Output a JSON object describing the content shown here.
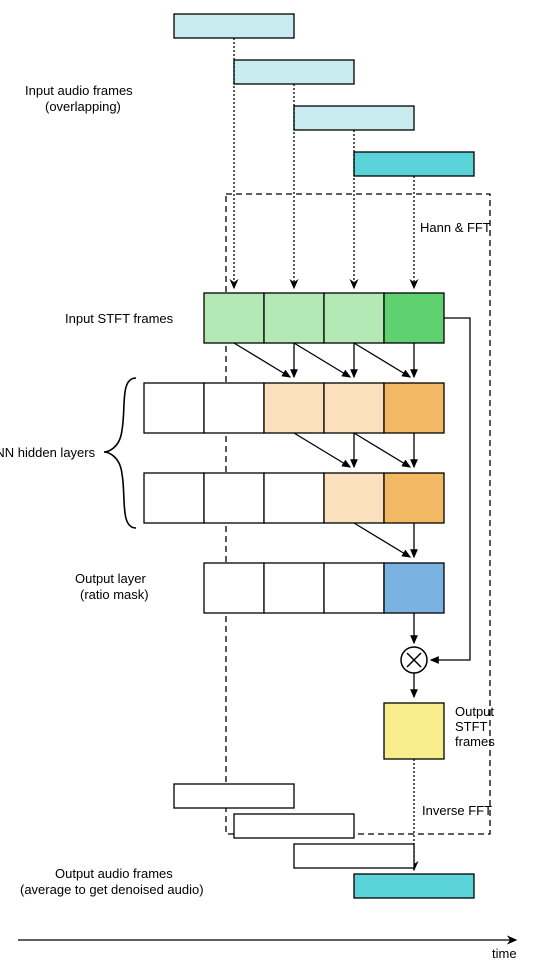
{
  "labels": {
    "input_audio": "Input audio frames",
    "input_audio_sub": "(overlapping)",
    "hann_fft": "Hann & FFT",
    "input_stft": "Input STFT frames",
    "cnn_hidden": "CNN hidden layers",
    "output_layer": "Output layer",
    "output_layer_sub": "(ratio mask)",
    "output_stft1": "Output",
    "output_stft2": "STFT",
    "output_stft3": "frames",
    "inverse_fft": "Inverse FFT",
    "output_audio1": "Output audio frames",
    "output_audio2": "(average to get denoised audio)",
    "time_axis": "time"
  },
  "colors": {
    "cyan_light": "#c7ebee",
    "cyan_dark": "#5ad4d9",
    "green_light": "#b3e9b4",
    "green_dark": "#5fd16f",
    "orange_light": "#fbe0bd",
    "orange_dark": "#f2b864",
    "blue": "#7ab2e2",
    "yellow": "#f9ee8e"
  },
  "chart_data": {
    "type": "diagram",
    "note": "Architecture diagram of a CNN-based audio denoising pipeline using STFT ratio masking.",
    "stages": [
      {
        "name": "Input audio frames (overlapping)",
        "count_shown": 4,
        "staggered": true
      },
      {
        "name": "Hann & FFT",
        "applied_per_frame": true
      },
      {
        "name": "Input STFT frames",
        "count_shown": 4
      },
      {
        "name": "CNN hidden layers",
        "layers_shown": 2,
        "cells_per_layer": 4,
        "receptive_shift": "left-context"
      },
      {
        "name": "Output layer (ratio mask)",
        "cells_shown": 4,
        "active_output_index": 3
      },
      {
        "name": "Elementwise multiply",
        "operands": [
          "ratio mask",
          "Input STFT frame (current)"
        ]
      },
      {
        "name": "Output STFT frames"
      },
      {
        "name": "Inverse FFT"
      },
      {
        "name": "Output audio frames (overlap-added / averaged)",
        "count_shown": 4,
        "staggered": true
      }
    ]
  }
}
